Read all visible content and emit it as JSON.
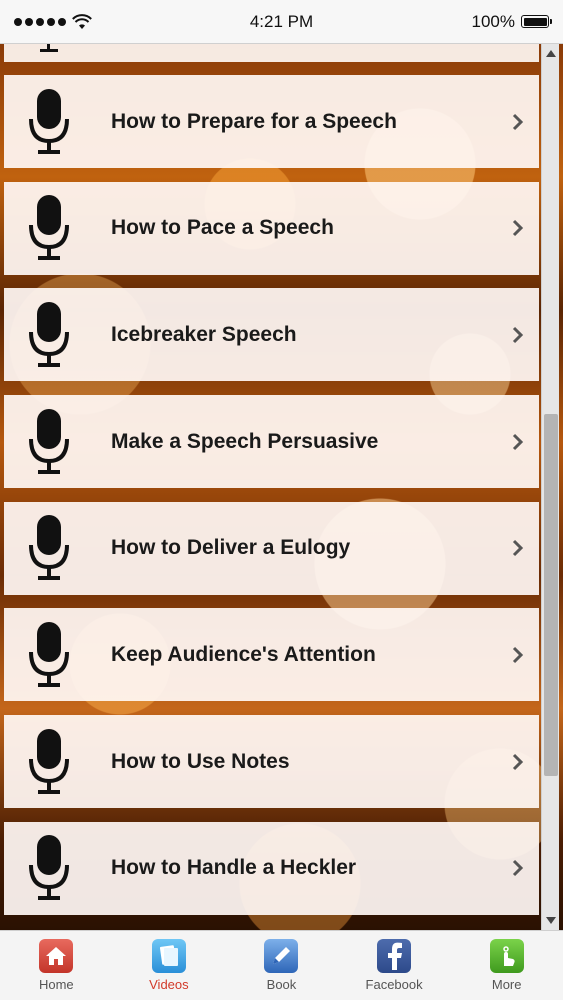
{
  "status_bar": {
    "time": "4:21 PM",
    "battery": "100%",
    "signal_icon": "signal-dots-icon",
    "wifi_icon": "wifi-icon"
  },
  "list": {
    "items": [
      {
        "label": "How to Prepare for a Speech",
        "icon": "microphone-icon"
      },
      {
        "label": "How to Pace a Speech",
        "icon": "microphone-icon"
      },
      {
        "label": "Icebreaker Speech",
        "icon": "microphone-icon"
      },
      {
        "label": "Make a Speech Persuasive",
        "icon": "microphone-icon"
      },
      {
        "label": "How to Deliver a Eulogy",
        "icon": "microphone-icon"
      },
      {
        "label": "Keep Audience's Attention",
        "icon": "microphone-icon"
      },
      {
        "label": "How to Use Notes",
        "icon": "microphone-icon"
      },
      {
        "label": "How to Handle a Heckler",
        "icon": "microphone-icon"
      }
    ]
  },
  "tab_bar": {
    "tabs": [
      {
        "label": "Home",
        "icon": "home-icon",
        "active": false
      },
      {
        "label": "Videos",
        "icon": "videos-icon",
        "active": true
      },
      {
        "label": "Book",
        "icon": "book-icon",
        "active": false
      },
      {
        "label": "Facebook",
        "icon": "facebook-icon",
        "active": false
      },
      {
        "label": "More",
        "icon": "more-icon",
        "active": false
      }
    ]
  },
  "colors": {
    "active_tab": "#d23a2a",
    "item_background": "#fff8f4",
    "background_accent": "#c0620f"
  }
}
